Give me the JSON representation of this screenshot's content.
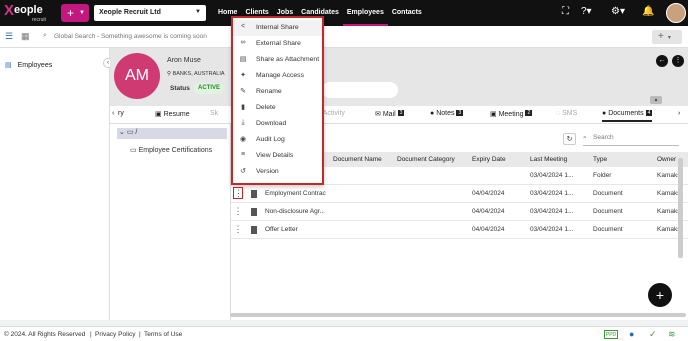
{
  "header": {
    "logo_text": "eople",
    "logo_x": "X",
    "logo_sub": "recruit",
    "add_label": "+",
    "company": "Xeople Recruit Ltd",
    "nav": [
      "Home",
      "Clients",
      "Jobs",
      "Candidates",
      "Employees",
      "Contacts"
    ],
    "active_nav": "Employees",
    "icons": [
      "expand-icon",
      "help-icon",
      "settings-icon",
      "bell-icon"
    ]
  },
  "subbar": {
    "search_placeholder": "Global Search - Something awesome is coming soon",
    "add_label": "+"
  },
  "sidebar": {
    "item": "Employees"
  },
  "profile": {
    "initials": "AM",
    "name": "Aron Muse",
    "location": "BANKS, AUSTRALIA",
    "status_label": "Status",
    "status_value": "ACTIVE"
  },
  "tabs": [
    {
      "label": "ry",
      "count": ""
    },
    {
      "label": "Resume",
      "count": ""
    },
    {
      "label": "Sk",
      "count": ""
    },
    {
      "label": "Activity",
      "count": ""
    },
    {
      "label": "Mail",
      "count": "3"
    },
    {
      "label": "Notes",
      "count": "3"
    },
    {
      "label": "Meeting",
      "count": "2"
    },
    {
      "label": "SMS",
      "count": ""
    },
    {
      "label": "Documents",
      "count": "4"
    }
  ],
  "tree": {
    "root": "/",
    "child": "Employee Certifications"
  },
  "documents": {
    "search_placeholder": "Search",
    "columns": [
      "Document Name",
      "Document Category",
      "Expiry Date",
      "Last Meeting",
      "Type",
      "Owner"
    ],
    "rows": [
      {
        "name": "",
        "category": "",
        "expiry": "",
        "last_meeting": "03/04/2024 1...",
        "type": "Folder",
        "owner": "Kamaks"
      },
      {
        "name": "Employment Contrac",
        "category": "",
        "expiry": "04/04/2024",
        "last_meeting": "03/04/2024 1...",
        "type": "Document",
        "owner": "Kamaks"
      },
      {
        "name": "Non-disclosure Agr...",
        "category": "",
        "expiry": "04/04/2024",
        "last_meeting": "03/04/2024 1...",
        "type": "Document",
        "owner": "Kamaks"
      },
      {
        "name": "Offer Letter",
        "category": "",
        "expiry": "04/04/2024",
        "last_meeting": "03/04/2024 1...",
        "type": "Document",
        "owner": "Kamaks"
      }
    ]
  },
  "context_menu": {
    "items": [
      {
        "label": "Internal Share",
        "icon": "share-icon"
      },
      {
        "label": "External Share",
        "icon": "link-icon"
      },
      {
        "label": "Share as Attachment",
        "icon": "attachment-icon"
      },
      {
        "label": "Manage Access",
        "icon": "access-icon"
      },
      {
        "label": "Rename",
        "icon": "rename-icon"
      },
      {
        "label": "Delete",
        "icon": "trash-icon"
      },
      {
        "label": "Download",
        "icon": "download-icon"
      },
      {
        "label": "Audit Log",
        "icon": "eye-icon"
      },
      {
        "label": "View Details",
        "icon": "details-icon"
      },
      {
        "label": "Version",
        "icon": "history-icon"
      }
    ]
  },
  "footer": {
    "copyright": "© 2024. All Rights Reserved",
    "privacy": "Privacy Policy",
    "terms": "Terms of Use",
    "sep": "|",
    "badge": "PPD"
  },
  "fab_label": "+"
}
